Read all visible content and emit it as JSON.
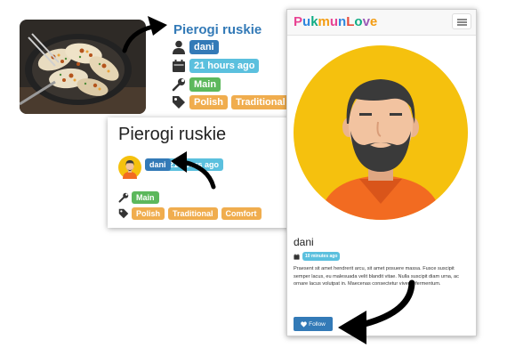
{
  "listing": {
    "title": "Pierogi ruskie",
    "user": "dani",
    "time": "21 hours ago",
    "course": "Main",
    "tags": [
      "Polish",
      "Traditional"
    ]
  },
  "detail": {
    "title": "Pierogi ruskie",
    "user": "dani",
    "time": "21 hours ago",
    "course": "Main",
    "tags": [
      "Polish",
      "Traditional",
      "Comfort"
    ]
  },
  "profile": {
    "brand_letters": [
      "P",
      "u",
      "k",
      "m",
      "u",
      "n",
      "L",
      "o",
      "v",
      "e"
    ],
    "brand_colors": [
      "#e84393",
      "#2e86de",
      "#10ac84",
      "#f39c12",
      "#e84393",
      "#2e86de",
      "#e74c3c",
      "#10ac84",
      "#9b59b6",
      "#f39c12"
    ],
    "name": "dani",
    "joined": "10 minutes ago",
    "bio": "Praesent sit amet hendrerit arcu, sit amet posuere massa. Fusce suscipit semper lacus, eu malesuada velit blandit vitae. Nulla suscipit diam urna, ac ornare lacus volutpat in. Maecenas consectetur viverra fermentum.",
    "follow_label": "Follow"
  },
  "colors": {
    "link": "#337ab7",
    "badge_blue": "#337ab7",
    "badge_cyan": "#5bc0de",
    "badge_green": "#5cb85c",
    "badge_orange": "#f0ad4e",
    "avatar_bg": "#f5c10e"
  },
  "icons": [
    "user-icon",
    "calendar-icon",
    "wrench-icon",
    "tag-icon",
    "heart-icon",
    "menu-icon"
  ]
}
